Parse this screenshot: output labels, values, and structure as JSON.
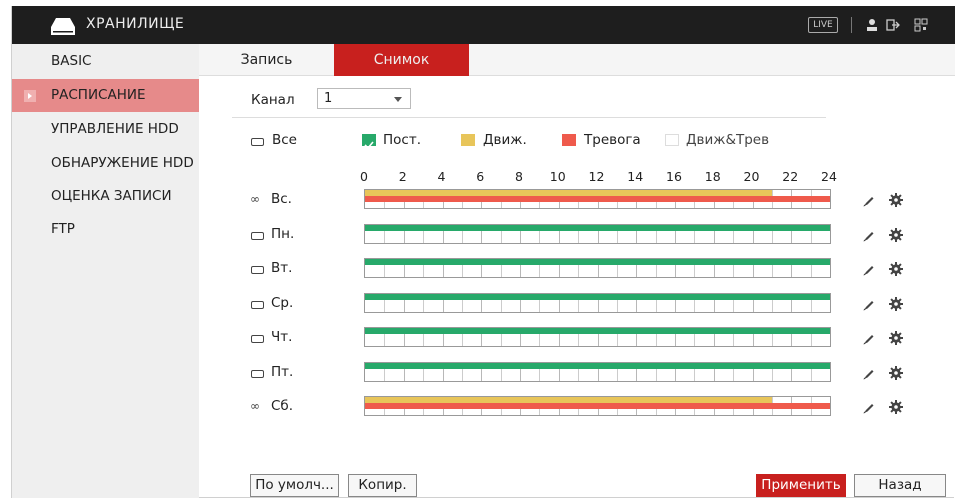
{
  "header": {
    "title": "ХРАНИЛИЩЕ",
    "live_label": "LIVE"
  },
  "sidebar": {
    "items": [
      {
        "label": "BASIC"
      },
      {
        "label": "РАСПИСАНИЕ",
        "active": true
      },
      {
        "label": "УПРАВЛЕНИЕ HDD"
      },
      {
        "label": "ОБНАРУЖЕНИЕ HDD"
      },
      {
        "label": "ОЦЕНКА ЗАПИСИ"
      },
      {
        "label": "FTP"
      }
    ]
  },
  "tabs": [
    {
      "label": "Запись"
    },
    {
      "label": "Снимок",
      "active": true
    }
  ],
  "channel": {
    "label": "Канал",
    "value": "1"
  },
  "legend": {
    "all": "Все",
    "items": [
      {
        "label": "Пост.",
        "color": "#27a96a",
        "checked": true
      },
      {
        "label": "Движ.",
        "color": "#e8c55a"
      },
      {
        "label": "Тревога",
        "color": "#ef5a4c"
      },
      {
        "label": "Движ&Трев",
        "color": "#ffffff"
      }
    ]
  },
  "timeline": {
    "ticks": [
      "0",
      "2",
      "4",
      "6",
      "8",
      "10",
      "12",
      "14",
      "16",
      "18",
      "20",
      "22",
      "24"
    ]
  },
  "schedule": [
    {
      "day": "Вс.",
      "linked": true,
      "segments": [
        {
          "type": "motion",
          "start": 0,
          "end": 21
        },
        {
          "type": "alarm",
          "start": 0,
          "end": 24
        }
      ]
    },
    {
      "day": "Пн.",
      "linked": false,
      "segments": [
        {
          "type": "regular",
          "start": 0,
          "end": 24
        }
      ]
    },
    {
      "day": "Вт.",
      "linked": false,
      "segments": [
        {
          "type": "regular",
          "start": 0,
          "end": 24
        }
      ]
    },
    {
      "day": "Ср.",
      "linked": false,
      "segments": [
        {
          "type": "regular",
          "start": 0,
          "end": 24
        }
      ]
    },
    {
      "day": "Чт.",
      "linked": false,
      "segments": [
        {
          "type": "regular",
          "start": 0,
          "end": 24
        }
      ]
    },
    {
      "day": "Пт.",
      "linked": false,
      "segments": [
        {
          "type": "regular",
          "start": 0,
          "end": 24
        }
      ]
    },
    {
      "day": "Сб.",
      "linked": true,
      "segments": [
        {
          "type": "motion",
          "start": 0,
          "end": 21
        },
        {
          "type": "alarm",
          "start": 0,
          "end": 24
        }
      ]
    }
  ],
  "segment_colors": {
    "regular": "#27a96a",
    "motion": "#e8c55a",
    "alarm": "#ef5a4c"
  },
  "buttons": {
    "default": "По умолч...",
    "copy": "Копир.",
    "apply": "Применить",
    "back": "Назад"
  }
}
